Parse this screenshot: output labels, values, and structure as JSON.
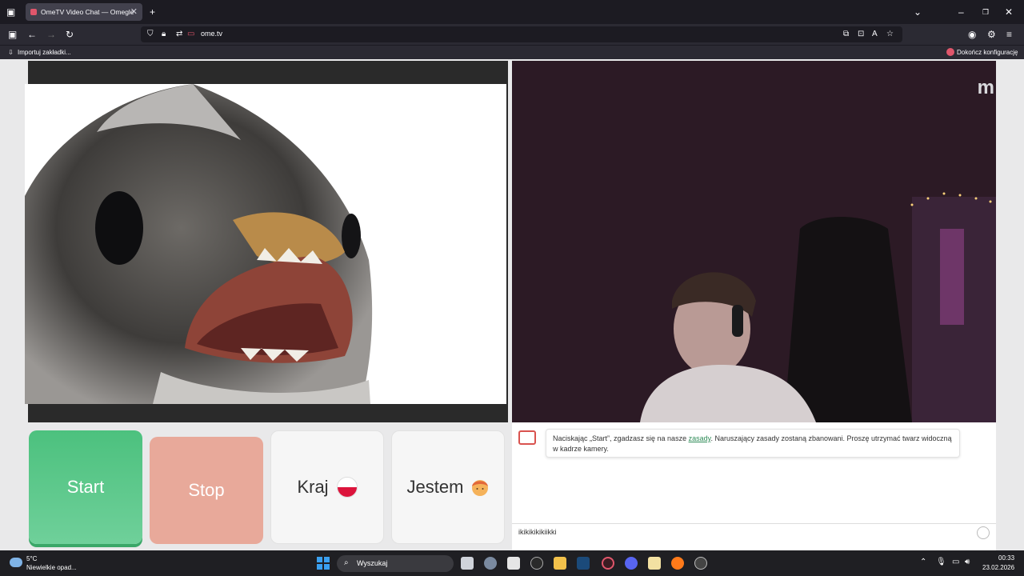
{
  "browser": {
    "tab_title": "OmeTV Video Chat — Omegle",
    "tab_close": "✕",
    "new_tab": "+",
    "url": "ome.tv",
    "bookmarks": {
      "import": "Importuj zakładki...",
      "finish_setup": "Dokończ konfigurację"
    }
  },
  "remote_video": {
    "brand_logo": "m"
  },
  "buttons": {
    "start": "Start",
    "stop": "Stop",
    "country": "Kraj",
    "gender": "Jestem"
  },
  "chat": {
    "system_message_prefix": "Naciskając „Start”, zgadzasz się na nasze ",
    "rules_link": "zasady",
    "system_message_suffix": ". Naruszający zasady zostaną zbanowani. Proszę utrzymać twarz widoczną w kadrze kamery.",
    "input_value": "ikikikikikiikki"
  },
  "taskbar": {
    "weather_temp": "5°C",
    "weather_desc": "Niewielkie opad...",
    "search_placeholder": "Wyszukaj",
    "time": "00:33",
    "date": "23.02.2026"
  },
  "colors": {
    "start": "#4cc17e",
    "stop": "#e8a99a",
    "link": "#2e8b57"
  }
}
